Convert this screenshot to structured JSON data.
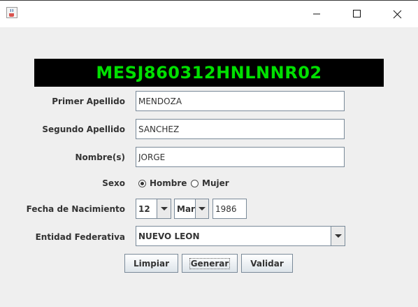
{
  "window": {
    "icons": {
      "app": "java-coffee-icon",
      "minimize": "minimize-icon",
      "maximize": "maximize-icon",
      "close": "close-icon"
    }
  },
  "banner": {
    "text": "MESJ860312HNLNNR02",
    "bg": "#000000",
    "fg": "#00e000"
  },
  "form": {
    "primer_apellido": {
      "label": "Primer Apellido",
      "value": "MENDOZA"
    },
    "segundo_apellido": {
      "label": "Segundo Apellido",
      "value": "SANCHEZ"
    },
    "nombres": {
      "label": "Nombre(s)",
      "value": "JORGE"
    },
    "sexo": {
      "label": "Sexo",
      "options": [
        "Hombre",
        "Mujer"
      ],
      "selected": "Hombre"
    },
    "fecha": {
      "label": "Fecha de Nacimiento",
      "day": "12",
      "month": "Mar",
      "year": "1986"
    },
    "entidad": {
      "label": "Entidad Federativa",
      "value": "NUEVO LEON"
    }
  },
  "buttons": {
    "limpiar": "Limpiar",
    "generar": "Generar",
    "validar": "Validar"
  }
}
